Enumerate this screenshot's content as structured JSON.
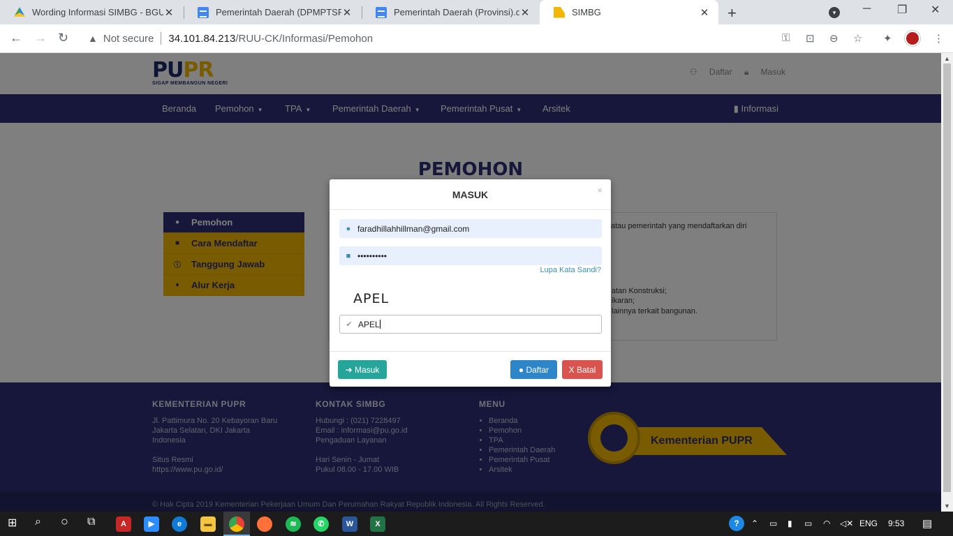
{
  "browser": {
    "tabs": [
      {
        "title": "Wording Informasi SIMBG - BGU",
        "icon": "google-drive-icon"
      },
      {
        "title": "Pemerintah Daerah (DPMPTSP K",
        "icon": "google-docs-icon"
      },
      {
        "title": "Pemerintah Daerah (Provinsi).doc",
        "icon": "google-docs-icon"
      },
      {
        "title": "SIMBG",
        "icon": "pupr-favicon"
      }
    ],
    "security": "Not secure",
    "url_host": "34.101.84.213",
    "url_path": "/RUU-CK/Informasi/Pemohon"
  },
  "site": {
    "logo_text_a": "PU",
    "logo_text_b": "PR",
    "logo_tagline": "SIGAP MEMBANGUN NEGERI",
    "header_links": {
      "daftar": "Daftar",
      "masuk": "Masuk"
    },
    "nav": [
      "Beranda",
      "Pemohon",
      "TPA",
      "Pemerintah Daerah",
      "Pemerintah Pusat",
      "Arsitek"
    ],
    "nav_info": "Informasi"
  },
  "content": {
    "heading": "PEMOHON",
    "sidebar": [
      "Pemohon",
      "Cara Mendaftar",
      "Tanggung Jawab",
      "Alur Kerja"
    ],
    "panel_lines": [
      "atau pemerintah yang mendaftarkan diri",
      "atan Konstruksi;",
      "ikaran;",
      "lainnya terkait bangunan."
    ]
  },
  "modal": {
    "title": "MASUK",
    "close": "×",
    "email_value": "faradhillahhillman@gmail.com",
    "password_value": "••••••••••",
    "forgot": "Lupa Kata Sandi?",
    "captcha_image_text": "APEL",
    "captcha_value": "APEL",
    "btn_masuk": "Masuk",
    "btn_daftar": "Daftar",
    "btn_batal": "X Batal"
  },
  "footer": {
    "col1_title": "KEMENTERIAN PUPR",
    "col1_lines": [
      "Jl. Pattimura No. 20 Kebayoran Baru",
      "Jakarta Selatan, DKI Jakarta",
      "Indonesia",
      "",
      "Situs Resmi",
      "https://www.pu.go.id/"
    ],
    "col2_title": "KONTAK SIMBG",
    "col2_lines": [
      "Hubungi : (021) 7228497",
      "Email : informasi@pu.go.id",
      "Pengaduan Layanan",
      "",
      "Hari Senin - Jumat",
      "Pukul 08.00 - 17.00 WIB"
    ],
    "col3_title": "MENU",
    "col3_items": [
      "Beranda",
      "Pemohon",
      "TPA",
      "Pemerintah Daerah",
      "Pemerintah Pusat",
      "Arsitek"
    ],
    "logo_text": "Kementerian PUPR",
    "copyright": "© Hak Cipta 2019 Kementerian Pekerjaan Umum Dan Perumahan Rakyat Republik Indonesia. All Rights Reserved."
  },
  "taskbar": {
    "language": "ENG",
    "time": "9:53"
  }
}
